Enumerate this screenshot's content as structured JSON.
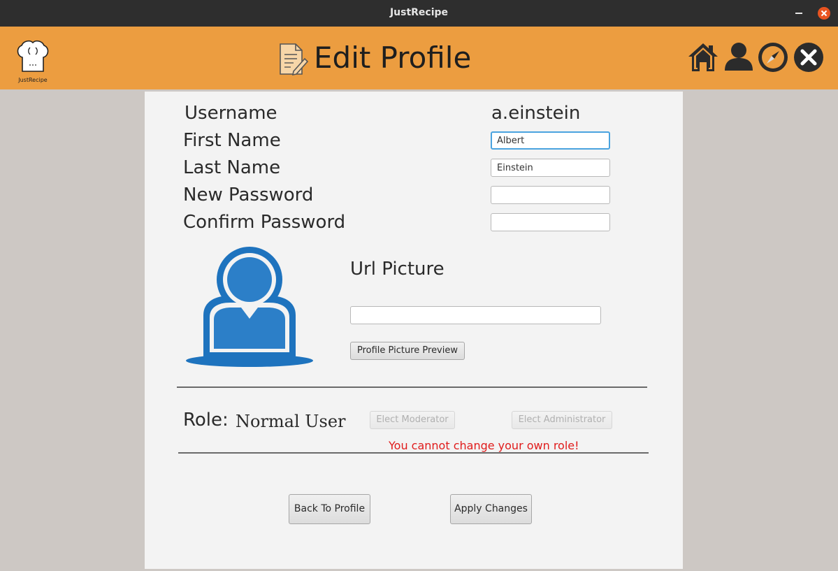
{
  "window": {
    "title": "JustRecipe"
  },
  "header": {
    "logo_text": "JustRecipe",
    "title": "Edit Profile",
    "nav_icons": [
      "home-icon",
      "user-icon",
      "compass-icon",
      "close-icon"
    ],
    "color": "#ec9d40"
  },
  "form": {
    "username_label": "Username",
    "username_value": "a.einstein",
    "first_name_label": "First Name",
    "first_name_value": "Albert",
    "last_name_label": "Last Name",
    "last_name_value": "Einstein",
    "new_password_label": "New Password",
    "new_password_value": "",
    "confirm_password_label": "Confirm Password",
    "confirm_password_value": ""
  },
  "picture": {
    "label": "Url Picture",
    "url_value": "",
    "preview_button": "Profile Picture Preview",
    "avatar_icon": "user-avatar-icon",
    "avatar_color": "#1e73be"
  },
  "role": {
    "label": "Role:",
    "value": "Normal User",
    "elect_moderator": "Elect Moderator",
    "elect_administrator": "Elect Administrator",
    "warning": "You cannot change your own role!",
    "warning_color": "#e01b1b"
  },
  "actions": {
    "back": "Back To Profile",
    "apply": "Apply Changes"
  }
}
